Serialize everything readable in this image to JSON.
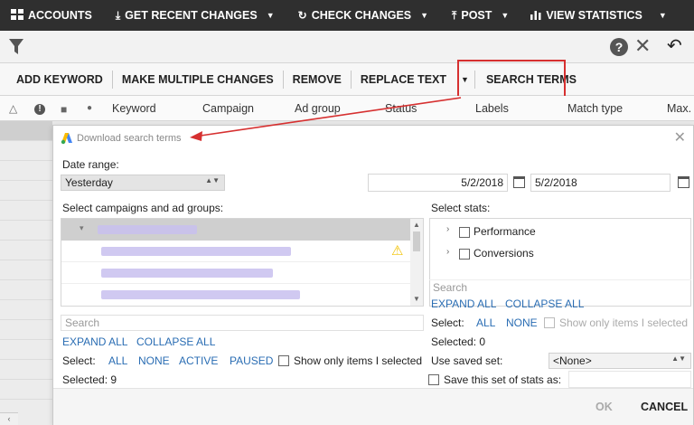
{
  "toolbar": {
    "items": [
      {
        "label": "ACCOUNTS",
        "icon": "grid-icon"
      },
      {
        "label": "GET RECENT CHANGES",
        "icon": "download-icon"
      },
      {
        "label": "CHECK CHANGES",
        "icon": "refresh-icon"
      },
      {
        "label": "POST",
        "icon": "upload-icon"
      },
      {
        "label": "VIEW STATISTICS",
        "icon": "bar-chart-icon"
      }
    ]
  },
  "actions": {
    "add_keyword": "ADD KEYWORD",
    "make_multiple_changes": "MAKE MULTIPLE CHANGES",
    "remove": "REMOVE",
    "replace_text": "REPLACE TEXT",
    "search_terms": "SEARCH TERMS"
  },
  "grid": {
    "columns": [
      "Keyword",
      "Campaign",
      "Ad group",
      "Status",
      "Labels",
      "Match type",
      "Max. C"
    ]
  },
  "dialog": {
    "title": "Download search terms",
    "date_range_label": "Date range:",
    "date_range_value": "Yesterday",
    "date_from": "5/2/2018",
    "date_to": "5/2/2018",
    "campaigns_label": "Select campaigns and ad groups:",
    "stats_label": "Select stats:",
    "stats_items": [
      "Performance",
      "Conversions"
    ],
    "left": {
      "search_placeholder": "Search",
      "expand_all": "EXPAND ALL",
      "collapse_all": "COLLAPSE ALL",
      "select_label": "Select:",
      "select_all": "ALL",
      "select_none": "NONE",
      "select_active": "ACTIVE",
      "select_paused": "PAUSED",
      "show_only_selected": "Show only items I selected",
      "selected_count": "Selected: 9"
    },
    "right": {
      "search_placeholder": "Search",
      "expand_all": "EXPAND ALL",
      "collapse_all": "COLLAPSE ALL",
      "select_label": "Select:",
      "select_all": "ALL",
      "select_none": "NONE",
      "show_only_selected": "Show only items I selected",
      "selected_count": "Selected: 0",
      "use_saved_set_label": "Use saved set:",
      "saved_set_value": "<None>",
      "save_set_label": "Save this set of stats as:"
    },
    "ok": "OK",
    "cancel": "CANCEL"
  },
  "colors": {
    "toolbar_bg": "#2f2f2f",
    "annotation": "#d63030",
    "link": "#2a6db3"
  }
}
